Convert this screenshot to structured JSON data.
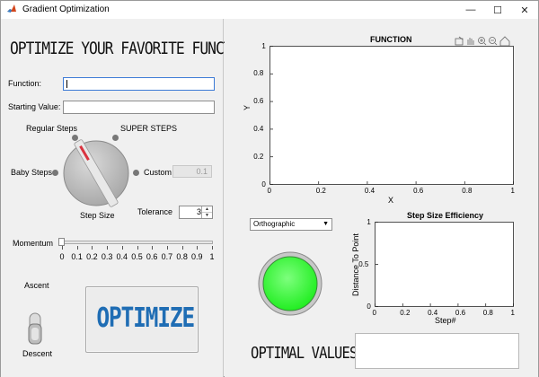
{
  "window": {
    "title": "Gradient Optimization",
    "minimize": "—",
    "maximize": "☐",
    "close": "✕"
  },
  "left": {
    "heading": "OPTIMIZE YOUR FAVORITE FUNCTION",
    "function_label": "Function:",
    "function_value": "",
    "start_label": "Starting Value:",
    "start_value": "",
    "knob": {
      "regular": "Regular Steps",
      "super": "SUPER STEPS",
      "baby": "Baby Steps",
      "custom": "Custom",
      "custom_value": "0.1",
      "title": "Step Size"
    },
    "tolerance_label": "Tolerance",
    "tolerance_value": "3",
    "momentum_label": "Momentum",
    "momentum_ticks": [
      "0",
      "0.1",
      "0.2",
      "0.3",
      "0.4",
      "0.5",
      "0.6",
      "0.7",
      "0.8",
      "0.9",
      "1"
    ],
    "momentum_value": 0,
    "ascent_label": "Ascent",
    "descent_label": "Descent",
    "optimize_label": "OPTIMIZE"
  },
  "right": {
    "main_plot": {
      "title": "FUNCTION",
      "xlabel": "X",
      "ylabel": "Y",
      "xticks": [
        "0",
        "0.2",
        "0.4",
        "0.6",
        "0.8",
        "1"
      ],
      "yticks": [
        "0",
        "0.2",
        "0.4",
        "0.6",
        "0.8",
        "1"
      ]
    },
    "projection": "Orthographic",
    "lamp_color": "#22ee22",
    "efficiency_plot": {
      "title": "Step Size Efficiency",
      "xlabel": "Step#",
      "ylabel": "Distance To Point",
      "xticks": [
        "0",
        "0.2",
        "0.4",
        "0.6",
        "0.8",
        "1"
      ],
      "yticks": [
        "0",
        "0.5",
        "1"
      ]
    },
    "optimal_label": "OPTIMAL VALUES:",
    "optimal_value": ""
  }
}
